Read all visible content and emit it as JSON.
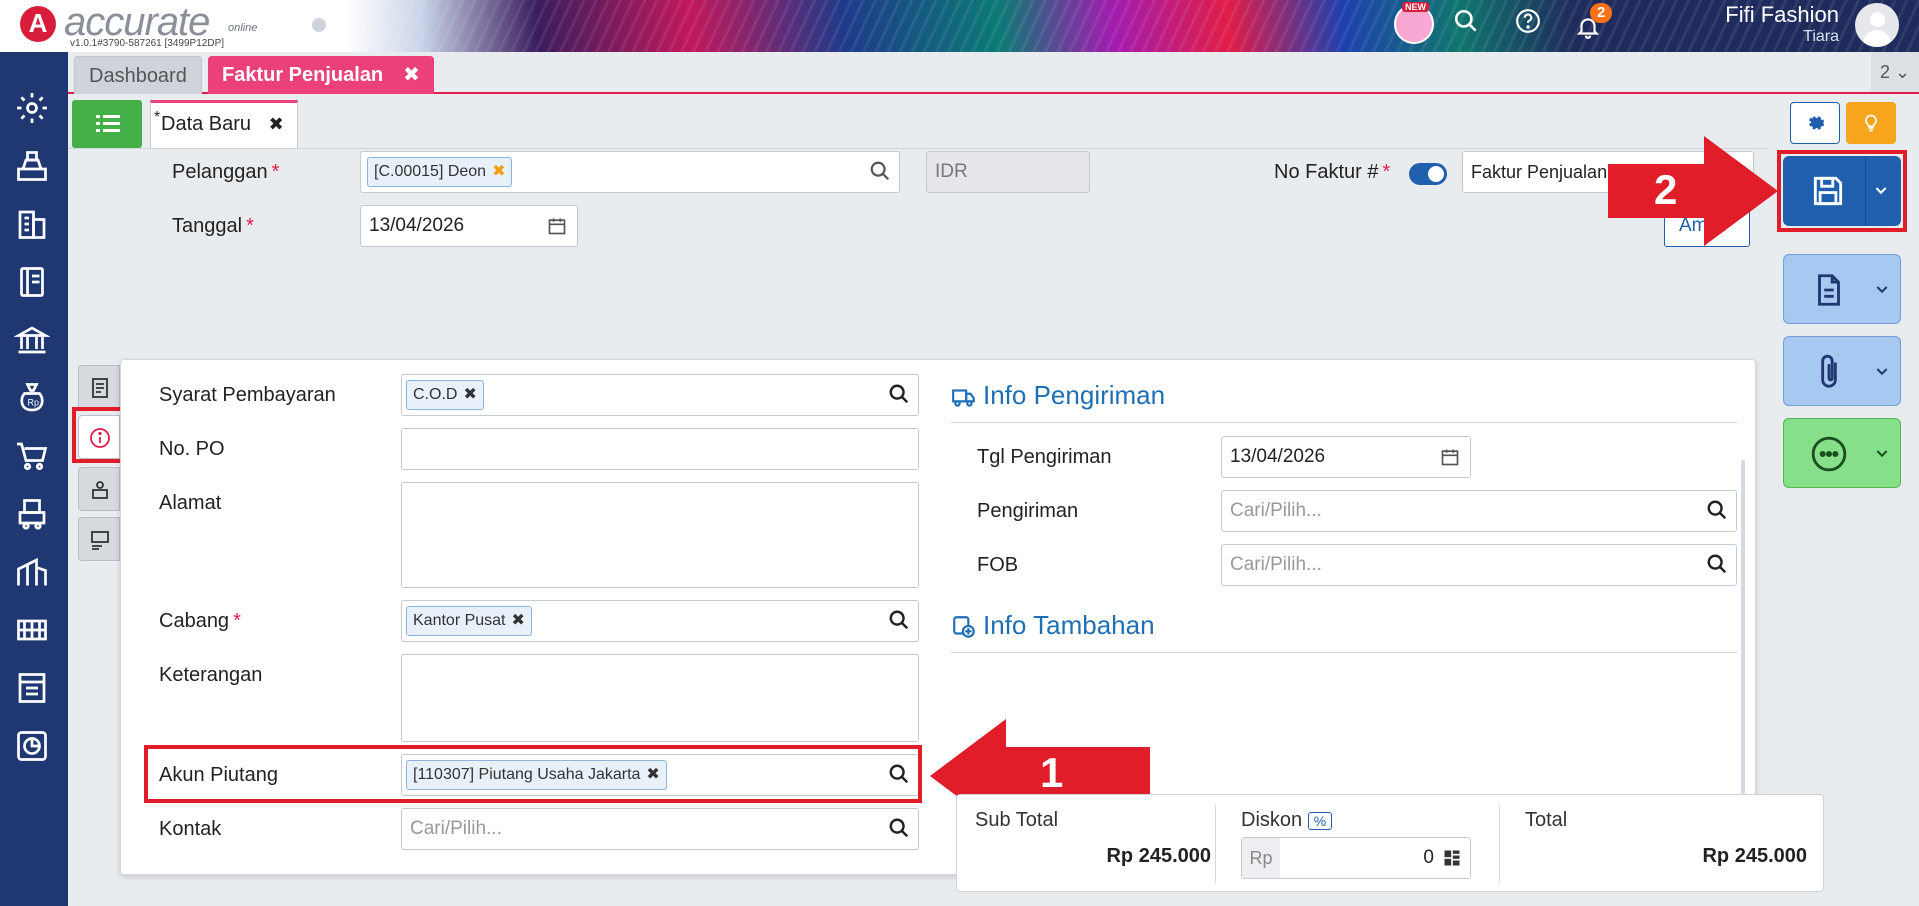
{
  "app": {
    "logo_text": "accurate",
    "logo_sub": "online",
    "version": "v1.0.1#3790-587261 [3499P12DP]",
    "new_tag": "NEW",
    "notification_count": "2",
    "user_name": "Fifi Fashion",
    "user_sub": "Tiara"
  },
  "tabs": {
    "dashboard": "Dashboard",
    "faktur": "Faktur Penjualan",
    "count": "2"
  },
  "subtab": {
    "star": "*",
    "label": "Data Baru"
  },
  "header_form": {
    "pelanggan_label": "Pelanggan",
    "pelanggan_value": "[C.00015] Deon",
    "currency": "IDR",
    "no_faktur_label": "No Faktur #",
    "no_faktur_value": "Faktur Penjualan",
    "tanggal_label": "Tanggal",
    "tanggal_value": "13/04/2026",
    "ambil_label": "Ambil"
  },
  "left_form": {
    "syarat_label": "Syarat Pembayaran",
    "syarat_value": "C.O.D",
    "nopo_label": "No. PO",
    "alamat_label": "Alamat",
    "cabang_label": "Cabang",
    "cabang_value": "Kantor Pusat",
    "keterangan_label": "Keterangan",
    "akun_label": "Akun Piutang",
    "akun_value": "[110307] Piutang Usaha Jakarta",
    "kontak_label": "Kontak",
    "kontak_placeholder": "Cari/Pilih..."
  },
  "right_form": {
    "info_pengiriman": "Info Pengiriman",
    "tgl_label": "Tgl Pengiriman",
    "tgl_value": "13/04/2026",
    "pengiriman_label": "Pengiriman",
    "pengiriman_placeholder": "Cari/Pilih...",
    "fob_label": "FOB",
    "fob_placeholder": "Cari/Pilih...",
    "info_tambahan": "Info Tambahan"
  },
  "totals": {
    "subtotal_label": "Sub Total",
    "subtotal_value": "Rp 245.000",
    "diskon_label": "Diskon",
    "diskon_badge": "%",
    "diskon_prefix": "Rp",
    "diskon_value": "0",
    "total_label": "Total",
    "total_value": "Rp 245.000"
  },
  "annotations": {
    "step1": "1",
    "step2": "2"
  },
  "colors": {
    "sidebar": "#1f3872",
    "accent_pink": "#ec407a",
    "primary_blue": "#1f5fae",
    "highlight_red": "#e11d2a"
  }
}
